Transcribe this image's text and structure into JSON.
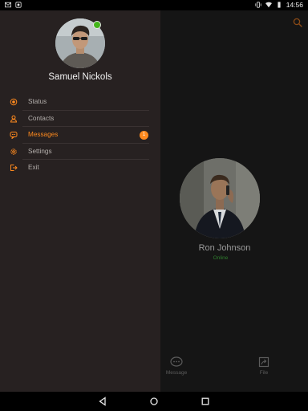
{
  "status_bar": {
    "time": "14:56",
    "left_icons": [
      "mail-icon",
      "app-icon"
    ],
    "right_icons": [
      "vibrate-icon",
      "wifi-icon",
      "battery-icon"
    ]
  },
  "drawer": {
    "user_name": "Samuel Nickols",
    "presence": "online",
    "menu": [
      {
        "label": "Status",
        "icon": "status-icon",
        "active": false
      },
      {
        "label": "Contacts",
        "icon": "contacts-icon",
        "active": false
      },
      {
        "label": "Messages",
        "icon": "messages-icon",
        "active": true,
        "badge": "1"
      },
      {
        "label": "Settings",
        "icon": "settings-icon",
        "active": false
      },
      {
        "label": "Exit",
        "icon": "exit-icon",
        "active": false
      }
    ]
  },
  "callee": {
    "name": "Ron Johnson",
    "status": "Online"
  },
  "actions": {
    "message": "Message",
    "file": "File"
  },
  "colors": {
    "accent": "#ff8a1e",
    "online": "#43b51b",
    "drawer_bg": "#272121"
  }
}
